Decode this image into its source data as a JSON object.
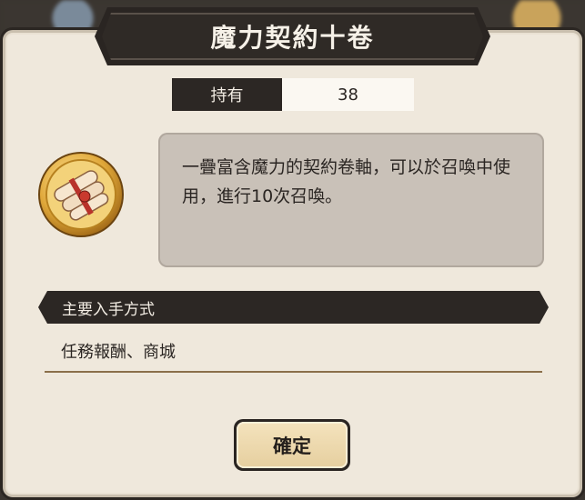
{
  "dialog": {
    "title": "魔力契約十卷",
    "holding": {
      "label": "持有",
      "value": "38"
    },
    "description": "一疊富含魔力的契約卷軸，可以於召喚中使用，進行10次召喚。",
    "item_icon": "contract-scrolls-icon",
    "acquire": {
      "title": "主要入手方式",
      "methods": "任務報酬、商城"
    },
    "confirm_label": "確定"
  },
  "colors": {
    "panel_bg": "#efe8dc",
    "dark_banner": "#2c2724",
    "desc_box": "#c9c1b8",
    "button_gold": "#e6cf9f",
    "divider": "#8a6f4a"
  }
}
